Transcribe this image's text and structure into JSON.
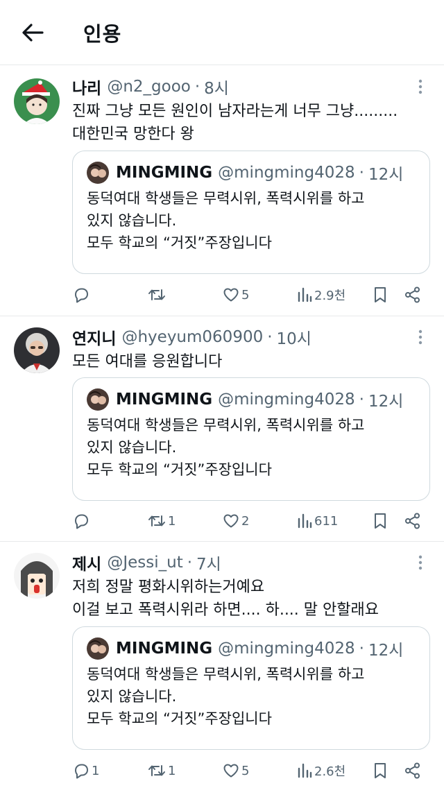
{
  "header": {
    "title": "인용"
  },
  "quoted": {
    "name": "MINGMING",
    "handle": "@mingming4028",
    "separator": "·",
    "time": "12시",
    "line1": "동덕여대 학생들은 무력시위, 폭력시위를 하고",
    "line2": "있지 않습니다.",
    "line3": "모두 학교의 “거짓”주장입니다"
  },
  "tweets": [
    {
      "name": "나리",
      "handle": "@n2_gooo",
      "separator": "·",
      "time": "8시",
      "line1": "진짜 그냥 모든 원인이 남자라는게 너무 그냥.........",
      "line2": "대한민국 망한다 왕",
      "replies": "",
      "retweets": "",
      "likes": "5",
      "views": "2.9천"
    },
    {
      "name": "연지니",
      "handle": "@hyeyum060900",
      "separator": "·",
      "time": "10시",
      "line1": "모든 여대를 응원합니다",
      "line2": "",
      "replies": "",
      "retweets": "1",
      "likes": "2",
      "views": "611"
    },
    {
      "name": "제시",
      "handle": "@Jessi_ut",
      "separator": "·",
      "time": "7시",
      "line1": "저희 정말 평화시위하는거예요",
      "line2": "이걸 보고 폭력시위라 하면.... 하.... 말 안할래요",
      "replies": "1",
      "retweets": "1",
      "likes": "5",
      "views": "2.6천"
    }
  ],
  "icons": {
    "back": "arrow-left-icon",
    "more": "more-vertical-icon",
    "reply": "reply-icon",
    "retweet": "retweet-icon",
    "like": "heart-icon",
    "views": "views-chart-icon",
    "bookmark": "bookmark-icon",
    "share": "share-icon"
  },
  "colors": {
    "text": "#0f1419",
    "secondary": "#536471",
    "border": "#cfd9de",
    "divider": "#e7e9ea"
  }
}
